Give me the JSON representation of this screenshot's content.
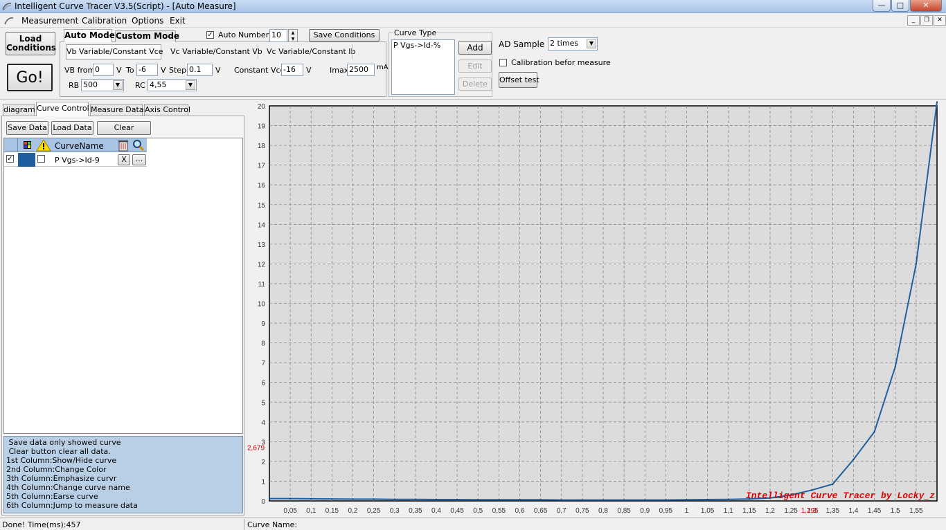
{
  "window": {
    "title": "Intelligent Curve Tracer V3.5(Script) - [Auto Measure]"
  },
  "menu": {
    "items": [
      "Measurement",
      "Calibration",
      "Options",
      "Exit"
    ]
  },
  "buttons": {
    "load_conditions_l1": "Load",
    "load_conditions_l2": "Conditions",
    "go": "Go!",
    "save_conditions": "Save Conditions",
    "add": "Add",
    "edit": "Edit",
    "delete": "Delete",
    "offset_test": "Offset test",
    "save_data": "Save Data",
    "load_data": "Load Data",
    "clear": "Clear"
  },
  "mode_tabs": {
    "auto": "Auto Mode",
    "custom": "Custom Mode"
  },
  "auto_number": {
    "label": "Auto Number",
    "checked": true,
    "value": "10"
  },
  "sub_tabs": [
    "Vb Variable/Constant Vce",
    "Vc Variable/Constant Vb",
    "Vc Variable/Constant Ib"
  ],
  "params": {
    "vb_from_label": "VB from",
    "vb_from": "0",
    "v1": "V",
    "to_label": "To",
    "to": "-6",
    "v2": "V",
    "step_label": "Step",
    "step": "0.1",
    "v3": "V",
    "const_vce_label": "Constant Vce",
    "const_vce": "-16",
    "v4": "V",
    "imax_label": "Imax",
    "imax": "2500",
    "ma": "mA",
    "rb_label": "RB",
    "rb": "500",
    "rc_label": "RC",
    "rc": "4,55"
  },
  "curve_type": {
    "label": "Curve Type",
    "items": [
      "P Vgs->Id-%"
    ]
  },
  "ad_sample": {
    "label": "AD Sample",
    "value": "2 times"
  },
  "calibration": {
    "label": "Calibration befor measure",
    "checked": false
  },
  "left_tabs": [
    "diagram",
    "Curve Control",
    "Measure Data",
    "Axis Control"
  ],
  "grid": {
    "header": "CurveName",
    "row_name": "P Vgs->Id-9",
    "row_checked": true,
    "row_color": "#1f5fa0",
    "erase": "X",
    "more": "..."
  },
  "help_lines": [
    " Save data only showed curve",
    " Clear button clear all data.",
    "1st Column:Show/Hide curve",
    "2nd Column:Change Color",
    "3th Column:Emphasize curvr",
    "4th Column:Change curve name",
    "5th Column:Earse curve",
    "6th Column:Jump to measure data"
  ],
  "status": {
    "left": "Done!  Time(ms):457",
    "right": "Curve Name:"
  },
  "chart_data": {
    "type": "line",
    "xlim": [
      0.0,
      1.6
    ],
    "ylim": [
      0,
      20
    ],
    "x_ticks": [
      "0,05",
      "0,1",
      "0,15",
      "0,2",
      "0,25",
      "0,3",
      "0,35",
      "0,4",
      "0,45",
      "0,5",
      "0,55",
      "0,6",
      "0,65",
      "0,7",
      "0,75",
      "0,8",
      "0,85",
      "0,9",
      "0,95",
      "1",
      "1,05",
      "1,1",
      "1,15",
      "1,2",
      "1,25",
      "1,3",
      "1,35",
      "1,4",
      "1,45",
      "1,5",
      "1,55"
    ],
    "y_ticks": [
      "0",
      "1",
      "2",
      "3",
      "4",
      "5",
      "6",
      "7",
      "8",
      "9",
      "10",
      "11",
      "12",
      "13",
      "14",
      "15",
      "16",
      "17",
      "18",
      "19",
      "20"
    ],
    "marker_y": "2,679",
    "marker_x": "1,295",
    "watermark": "Intelligent Curve Tracer by Locky_z",
    "grid": true,
    "series": [
      {
        "color": "#1f5fa0",
        "x": [
          0.0,
          0.05,
          0.1,
          0.15,
          0.2,
          0.25,
          0.3,
          0.35,
          0.4,
          0.45,
          0.5,
          0.55,
          0.6,
          0.65,
          0.7,
          0.75,
          0.8,
          0.85,
          0.9,
          0.95,
          1.0,
          1.05,
          1.1,
          1.15,
          1.2,
          1.25,
          1.3,
          1.35,
          1.4,
          1.45,
          1.5,
          1.55,
          1.6
        ],
        "y": [
          0.12,
          0.12,
          0.11,
          0.1,
          0.09,
          0.09,
          0.08,
          0.08,
          0.07,
          0.07,
          0.06,
          0.06,
          0.06,
          0.06,
          0.05,
          0.05,
          0.05,
          0.05,
          0.05,
          0.05,
          0.06,
          0.07,
          0.08,
          0.1,
          0.15,
          0.3,
          0.55,
          0.85,
          2.1,
          3.5,
          6.8,
          12.0,
          20.2
        ]
      }
    ]
  }
}
